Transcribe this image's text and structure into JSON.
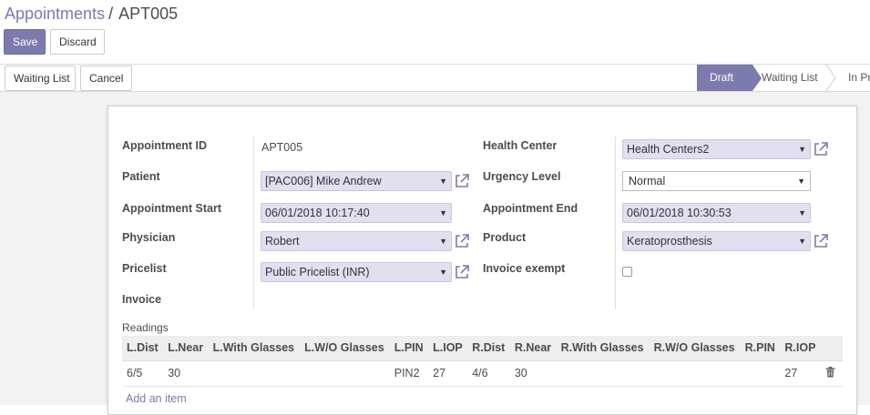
{
  "breadcrumb": {
    "parent": "Appointments",
    "separator": "/",
    "current": "APT005"
  },
  "actions": {
    "save_label": "Save",
    "discard_label": "Discard"
  },
  "header_buttons": {
    "waiting_list_label": "Waiting List",
    "cancel_label": "Cancel"
  },
  "statusbar": {
    "stages": [
      "Draft",
      "Waiting List",
      "In Pr"
    ],
    "active": "Draft"
  },
  "form": {
    "appointment_id": {
      "label": "Appointment ID",
      "value": "APT005"
    },
    "patient": {
      "label": "Patient",
      "value": "[PAC006] Mike Andrew"
    },
    "appointment_start": {
      "label": "Appointment Start",
      "value": "06/01/2018 10:17:40"
    },
    "physician": {
      "label": "Physician",
      "value": "Robert"
    },
    "pricelist": {
      "label": "Pricelist",
      "value": "Public Pricelist (INR)"
    },
    "invoice": {
      "label": "Invoice",
      "value": ""
    },
    "health_center": {
      "label": "Health Center",
      "value": "Health Centers2"
    },
    "urgency_level": {
      "label": "Urgency Level",
      "value": "Normal"
    },
    "appointment_end": {
      "label": "Appointment End",
      "value": "06/01/2018 10:30:53"
    },
    "product": {
      "label": "Product",
      "value": "Keratoprosthesis"
    },
    "invoice_exempt": {
      "label": "Invoice exempt",
      "checked": false
    }
  },
  "readings": {
    "title": "Readings",
    "columns": [
      "L.Dist",
      "L.Near",
      "L.With Glasses",
      "L.W/O Glasses",
      "L.PIN",
      "L.IOP",
      "R.Dist",
      "R.Near",
      "R.With Glasses",
      "R.W/O Glasses",
      "R.PIN",
      "R.IOP"
    ],
    "rows": [
      [
        "6/5",
        "30",
        "",
        "",
        "PIN2",
        "27",
        "4/6",
        "30",
        "",
        "",
        "",
        "27"
      ]
    ],
    "add_item_label": "Add an item"
  },
  "colors": {
    "accent": "#7c7bad",
    "many2one_bg": "#e1dff0",
    "sheet_bg": "#f2f2f2"
  },
  "icons": [
    "external-link-icon",
    "caret-down-icon",
    "trash-icon"
  ]
}
